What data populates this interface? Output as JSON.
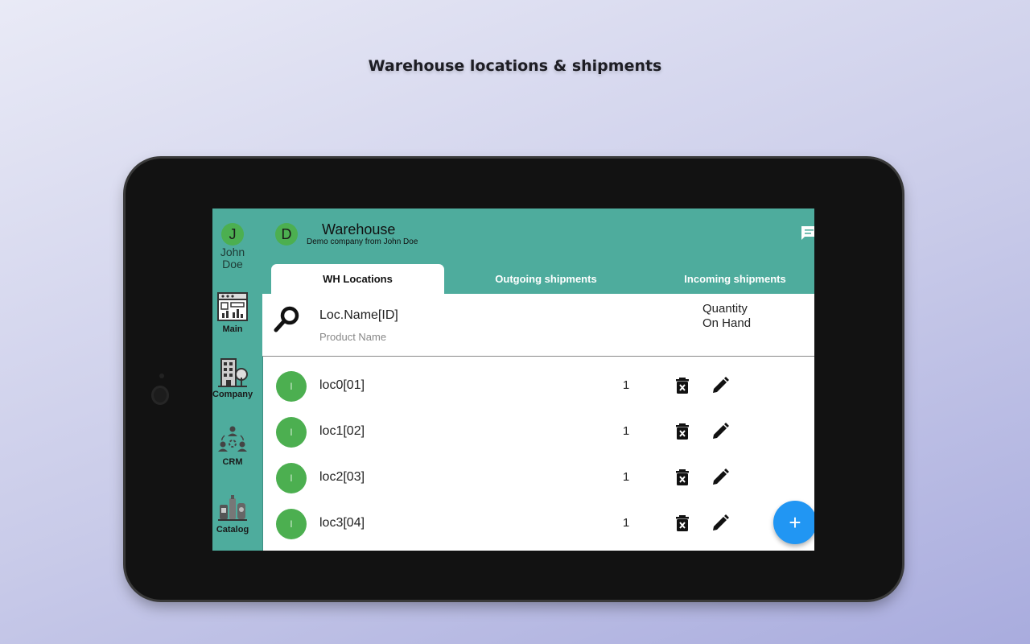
{
  "headline": "Warehouse locations & shipments",
  "sidebar": {
    "user_initial": "J",
    "user_name": "John Doe",
    "items": [
      {
        "label": "Main",
        "icon": "dashboard-icon"
      },
      {
        "label": "Company",
        "icon": "building-icon"
      },
      {
        "label": "CRM",
        "icon": "people-icon"
      },
      {
        "label": "Catalog",
        "icon": "products-icon"
      }
    ]
  },
  "header": {
    "company_initial": "D",
    "title": "Warehouse",
    "subtitle": "Demo company from John Doe",
    "chat_icon": "chat-icon"
  },
  "tabs": [
    {
      "label": "WH Locations",
      "active": true
    },
    {
      "label": "Outgoing shipments",
      "active": false
    },
    {
      "label": "Incoming shipments",
      "active": false
    }
  ],
  "list_header": {
    "name_label": "Loc.Name[ID]",
    "product_label": "Product Name",
    "quantity_label": "Quantity On Hand"
  },
  "rows": [
    {
      "avatar": "l",
      "name": "loc0[01]",
      "qty": "1"
    },
    {
      "avatar": "l",
      "name": "loc1[02]",
      "qty": "1"
    },
    {
      "avatar": "l",
      "name": "loc2[03]",
      "qty": "1"
    },
    {
      "avatar": "l",
      "name": "loc3[04]",
      "qty": "1"
    }
  ],
  "fab_label": "+",
  "colors": {
    "primary": "#4eac9d",
    "avatar_green": "#4caf50",
    "fab_blue": "#2196f3",
    "background_start": "#e9eaf6",
    "background_end": "#a9acde"
  }
}
